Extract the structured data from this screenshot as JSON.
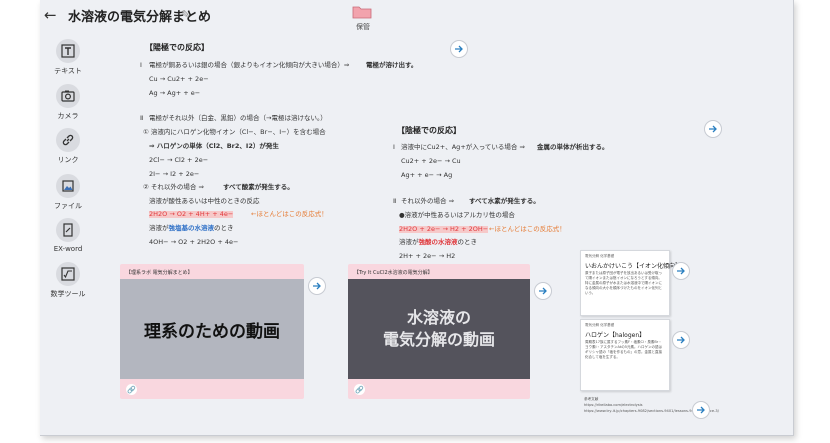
{
  "header": {
    "back": "←",
    "title": "水溶液の電気分解まとめ",
    "edit": "✎",
    "save_label": "保管"
  },
  "sidebar": [
    {
      "key": "text",
      "label": "テキスト"
    },
    {
      "key": "camera",
      "label": "カメラ"
    },
    {
      "key": "link",
      "label": "リンク"
    },
    {
      "key": "file",
      "label": "ファイル"
    },
    {
      "key": "exword",
      "label": "EX-word"
    },
    {
      "key": "math",
      "label": "数学ツール"
    }
  ],
  "anode": {
    "heading": "【陽極での反応】",
    "l1_num": "Ⅰ",
    "l1_text": "電極が銅あるいは銀の場合（銀よりもイオン化傾向が大きい場合）⇒",
    "l1_bold": "電極が溶け出す。",
    "eq1": "Cu → Cu2+ + 2e−",
    "eq2": "Ag → Ag+ + e−",
    "l2_num": "Ⅱ",
    "l2_text": "電極がそれ以外（白金、黒鉛）の場合（→電極は溶けない。）",
    "s1": "①  溶液内にハロゲン化物イオン（Cl−、Br−、I−）を含む場合",
    "s1_bold": "⇒  ハロゲンの単体（Cl2、Br2、I2）が発生",
    "eq3": "2Cl− → Cl2 + 2e−",
    "eq4": "2I− → I2 + 2e−",
    "s2": "②  それ以外の場合  ⇒",
    "s2_bold": "すべて酸素が発生する。",
    "s2a": "溶液が酸性あるいは中性のときの反応",
    "eq5": "2H2O → O2 + 4H+ + 4e−",
    "eq5_note": "←ほとんどはこの反応式！",
    "s2b_pre": "溶液が",
    "s2b_hl": "強塩基の水溶液",
    "s2b_post": "のとき",
    "eq6": "4OH− → O2 + 2H2O + 4e−"
  },
  "cathode": {
    "heading": "【陰極での反応】",
    "l1_num": "Ⅰ",
    "l1_text": "溶液中にCu2+、Ag+が入っている場合  ⇒",
    "l1_bold": "金属の単体が析出する。",
    "eq1": "Cu2+ + 2e− → Cu",
    "eq2": "Ag+ + e− → Ag",
    "l2_num": "Ⅱ",
    "l2_text": "それ以外の場合  ⇒",
    "l2_bold": "すべて水素が発生する。",
    "s1": "●溶液が中性あるいはアルカリ性の場合",
    "eq3": "2H2O + 2e− → H2 + 2OH−",
    "eq3_note": "←ほとんどはこの反応式！",
    "s2_pre": "溶液が",
    "s2_hl": "強酸の水溶液",
    "s2_post": "のとき",
    "eq4": "2H+ + 2e− → H2"
  },
  "videos": [
    {
      "caption": "【理系ラボ  電気分解まとめ】",
      "thumb": "理系のための動画",
      "thumb_bg": "#b3b6bf",
      "thumb_color": "#111111"
    },
    {
      "caption": "【Try It CuCl2水溶液の電気分解】",
      "thumb": "水溶液の\n電気分解の動画",
      "thumb_bg": "#54535c",
      "thumb_color": "#e6e6e9"
    }
  ],
  "notes": [
    {
      "tiny": "電気分解  化学基礎",
      "title": "いおんかけいこう【イオン化傾向】",
      "body": "原子または原子団が電子を放出あるいは受け取って陽イオンまたは陰イオンになろうとする傾向。特に金属の原子が水または水溶液中で陽イオンになる傾向の大小を順序づけたものをイオン化列という。"
    },
    {
      "tiny": "電気分解  化学基礎",
      "title": "ハロゲン【halogen】",
      "body": "周期表17族に属するフッ素F・塩素Cl・臭素Br・ヨウ素I・アスタチンAtの5元素。ハロゲンの語はギリシャ語の「塩を作るもの」の意。金属と直接化合して塩を生ずる。"
    }
  ],
  "reference": {
    "label": "参考文献",
    "line1": "https://rikeilabo.com/electrolysis",
    "line2": "https://www.try-it.jp/chapters-9082/sections-9401/lessons-9469/practice-3/"
  }
}
